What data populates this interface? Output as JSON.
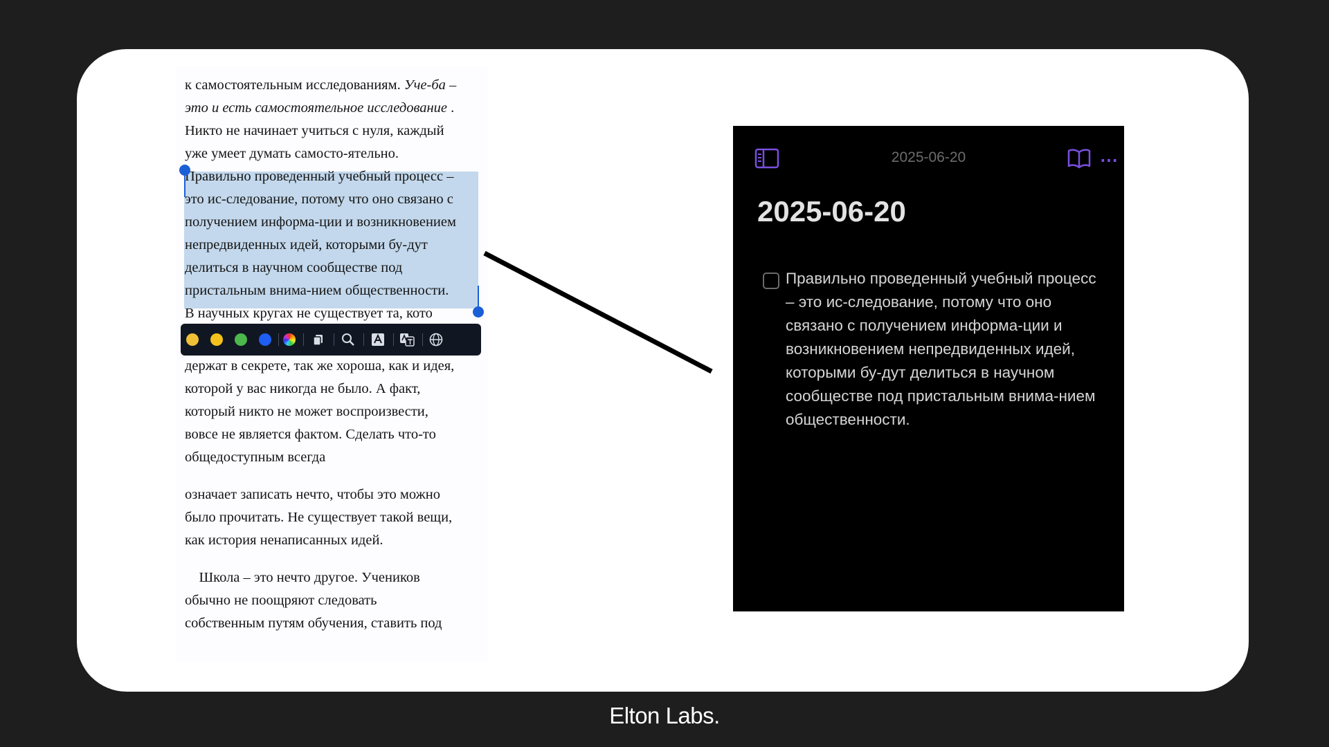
{
  "reader": {
    "lines_before": [
      {
        "plain": "к самостоятельным исследованиям. ",
        "italic": "Уче-ба –"
      },
      {
        "plain": "",
        "italic": "это и есть самостоятельное исследование",
        "tail": " ."
      },
      {
        "plain": "Никто не начинает учиться с нуля, каждый"
      },
      {
        "plain": "уже умеет думать самосто-ятельно."
      }
    ],
    "selected_lines": [
      "Правильно проведенный учебный процесс –",
      "это ис-следование, потому что оно связано с",
      "получением информа-ции и возникновением",
      "непредвиденных идей, которыми бу-дут",
      "делиться в научном сообществе под",
      "пристальным внима-нием общественности."
    ],
    "partial_line": "В научных кругах не существует та, кото",
    "lines_after": [
      "держат в секрете, так же хороша, как и идея,",
      "которой у вас никогда не было. А факт,",
      "который никто не может воспроизвести,",
      "вовсе не является фактом. Сделать что-то",
      "общедоступным всегда",
      "означает записать нечто, чтобы это можно",
      "было прочитать. Не существует такой вещи,",
      "как история ненаписанных идей.",
      "    Школа – это нечто другое. Учеников",
      "обычно не поощряют следовать",
      "собственным путям обучения, ставить под"
    ]
  },
  "toolbar": {
    "colors": [
      "#f2c037",
      "#f3c21c",
      "#4cb84c",
      "#1e5ef2"
    ],
    "icons": [
      "color-wheel-icon",
      "copy-icon",
      "search-icon",
      "text-style-icon",
      "translate-icon",
      "web-search-icon"
    ]
  },
  "note": {
    "header_date": "2025-06-20",
    "title": "2025-06-20",
    "task_lines": [
      "Правильно проведенный учебный процесс",
      "– это ис-следование, потому что оно",
      "связано с получением информа-ции и",
      "возникновением непредвиденных идей,",
      "которыми бу-дут делиться в научном",
      "сообществе под пристальным внима-нием",
      "общественности."
    ],
    "accent_color": "#7b4fe0"
  },
  "brand": "Elton Labs."
}
